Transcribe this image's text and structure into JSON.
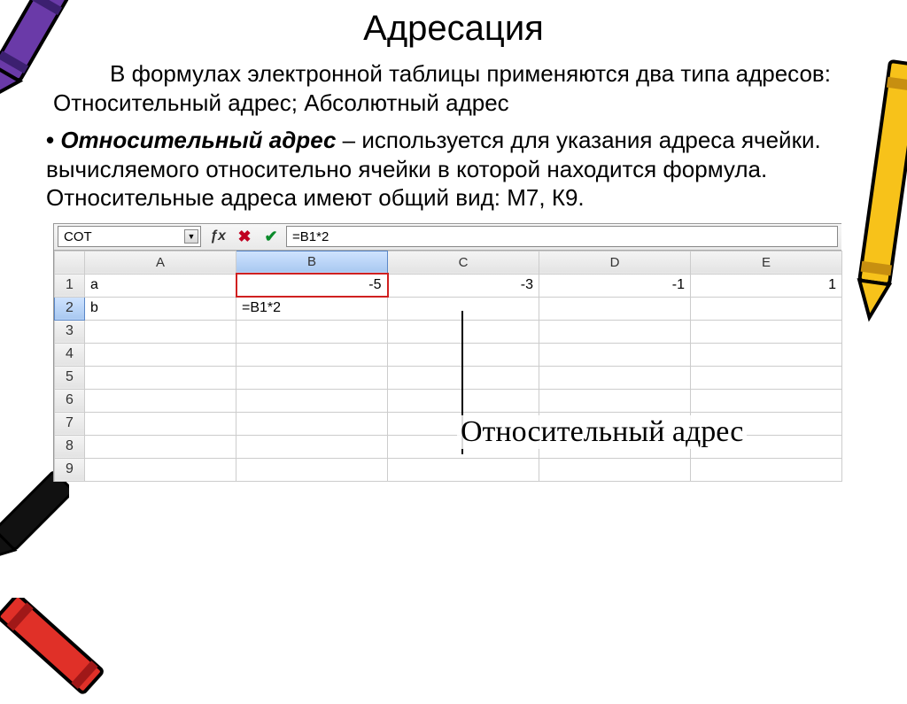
{
  "title": "Адресация",
  "intro": "В формулах электронной таблицы применяются два типа адресов:  Относительный адрес; Абсолютный адрес",
  "body": {
    "term": "Относительный адрес",
    "desc": " – используется для указания адреса ячейки. вычисляемого относительно ячейки в которой находится формула. Относительные адреса имеют общий вид: М7, К9."
  },
  "sheet": {
    "name_box": "COT",
    "formula_input": "=B1*2",
    "columns": [
      "A",
      "B",
      "C",
      "D",
      "E"
    ],
    "rows": [
      "1",
      "2",
      "3",
      "4",
      "5",
      "6",
      "7",
      "8",
      "9"
    ],
    "cells": {
      "A1": "a",
      "B1": "-5",
      "C1": "-3",
      "D1": "-1",
      "E1": "1",
      "A2": "b",
      "B2": "=B1*2"
    },
    "active_col": "B",
    "active_row": "2"
  },
  "annotation": "Относительный адрес"
}
